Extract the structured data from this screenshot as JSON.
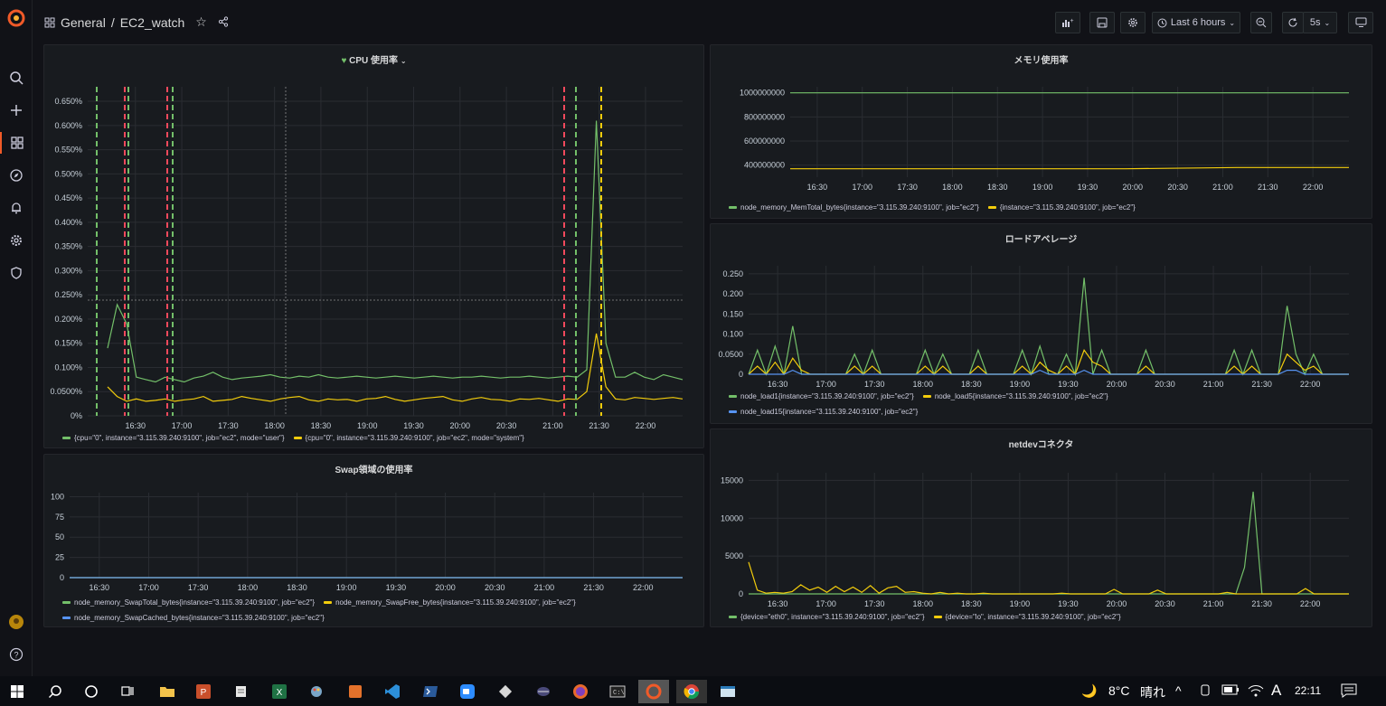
{
  "breadcrumb": {
    "folder": "General",
    "separator": "/",
    "dashboard": "EC2_watch"
  },
  "toolbar": {
    "time_range": "Last 6 hours",
    "refresh_interval": "5s"
  },
  "colors": {
    "green": "#73bf69",
    "yellow": "#f2cc0c",
    "blue": "#5794f2",
    "red_marker": "#f2495c",
    "accent": "#f05a28"
  },
  "panels": {
    "cpu": {
      "title": "CPU 使用率",
      "legend": [
        "{cpu=\"0\", instance=\"3.115.39.240:9100\", job=\"ec2\", mode=\"user\"}",
        "{cpu=\"0\", instance=\"3.115.39.240:9100\", job=\"ec2\", mode=\"system\"}"
      ]
    },
    "memory": {
      "title": "メモリ使用率",
      "legend": [
        "node_memory_MemTotal_bytes{instance=\"3.115.39.240:9100\", job=\"ec2\"}",
        "{instance=\"3.115.39.240:9100\", job=\"ec2\"}"
      ]
    },
    "load": {
      "title": "ロードアベレージ",
      "legend": [
        "node_load1{instance=\"3.115.39.240:9100\", job=\"ec2\"}",
        "node_load5{instance=\"3.115.39.240:9100\", job=\"ec2\"}",
        "node_load15{instance=\"3.115.39.240:9100\", job=\"ec2\"}"
      ]
    },
    "swap": {
      "title": "Swap領域の使用率",
      "legend": [
        "node_memory_SwapTotal_bytes{instance=\"3.115.39.240:9100\", job=\"ec2\"}",
        "node_memory_SwapFree_bytes{instance=\"3.115.39.240:9100\", job=\"ec2\"}",
        "node_memory_SwapCached_bytes{instance=\"3.115.39.240:9100\", job=\"ec2\"}"
      ]
    },
    "net": {
      "title": "netdevコネクタ",
      "legend": [
        "{device=\"eth0\", instance=\"3.115.39.240:9100\", job=\"ec2\"}",
        "{device=\"lo\", instance=\"3.115.39.240:9100\", job=\"ec2\"}"
      ]
    }
  },
  "chart_data": [
    {
      "type": "line",
      "title": "CPU 使用率",
      "x_ticks": [
        "16:30",
        "17:00",
        "17:30",
        "18:00",
        "18:30",
        "19:00",
        "19:30",
        "20:00",
        "20:30",
        "21:00",
        "21:30",
        "22:00"
      ],
      "y_ticks": [
        "0%",
        "0.0500%",
        "0.100%",
        "0.150%",
        "0.200%",
        "0.250%",
        "0.300%",
        "0.350%",
        "0.400%",
        "0.450%",
        "0.500%",
        "0.550%",
        "0.600%",
        "0.650%"
      ],
      "ylim": [
        0,
        0.0068
      ],
      "series": [
        {
          "name": "{cpu=\"0\", instance=\"3.115.39.240:9100\", job=\"ec2\", mode=\"user\"}",
          "values": [
            0.0014,
            0.0023,
            0.0019,
            0.0008,
            0.00075,
            0.0007,
            0.0008,
            0.00075,
            0.0007,
            0.00078,
            0.00082,
            0.0009,
            0.0008,
            0.00075,
            0.00078,
            0.0008,
            0.00082,
            0.00085,
            0.0008,
            0.00078,
            0.00082,
            0.0008,
            0.00085,
            0.0008,
            0.00078,
            0.0008,
            0.00082,
            0.0008,
            0.00078,
            0.0008,
            0.00082,
            0.0008,
            0.00078,
            0.0008,
            0.00082,
            0.0008,
            0.00078,
            0.0008,
            0.0008,
            0.00082,
            0.0008,
            0.00078,
            0.0008,
            0.0008,
            0.00082,
            0.0008,
            0.00078,
            0.0008,
            0.00082,
            0.0008,
            0.00095,
            0.0061,
            0.0015,
            0.0008,
            0.0008,
            0.0009,
            0.0008,
            0.00075,
            0.00085,
            0.0008,
            0.00075
          ]
        },
        {
          "name": "{cpu=\"0\", instance=\"3.115.39.240:9100\", job=\"ec2\", mode=\"system\"}",
          "values": [
            0.0006,
            0.0004,
            0.0003,
            0.00035,
            0.0003,
            0.00032,
            0.00035,
            0.0003,
            0.00033,
            0.00035,
            0.0004,
            0.0003,
            0.00032,
            0.00034,
            0.0004,
            0.00036,
            0.00033,
            0.0003,
            0.00035,
            0.00038,
            0.0004,
            0.00033,
            0.0003,
            0.00035,
            0.00033,
            0.00034,
            0.0003,
            0.00035,
            0.00036,
            0.0004,
            0.00034,
            0.0003,
            0.00033,
            0.00036,
            0.00038,
            0.0004,
            0.00033,
            0.0003,
            0.00035,
            0.00038,
            0.00034,
            0.00033,
            0.0003,
            0.00035,
            0.00034,
            0.00036,
            0.00033,
            0.0003,
            0.00035,
            0.00034,
            0.0005,
            0.0017,
            0.0006,
            0.00035,
            0.00033,
            0.00038,
            0.00036,
            0.00034,
            0.00036,
            0.00038,
            0.00035
          ]
        }
      ]
    },
    {
      "type": "line",
      "title": "メモリ使用率",
      "x_ticks": [
        "16:30",
        "17:00",
        "17:30",
        "18:00",
        "18:30",
        "19:00",
        "19:30",
        "20:00",
        "20:30",
        "21:00",
        "21:30",
        "22:00"
      ],
      "y_ticks": [
        "400000000",
        "600000000",
        "800000000",
        "1000000000"
      ],
      "ylim": [
        300000000,
        1050000000
      ],
      "series": [
        {
          "name": "node_memory_MemTotal_bytes{instance=\"3.115.39.240:9100\", job=\"ec2\"}",
          "values": [
            1000000000,
            1000000000
          ]
        },
        {
          "name": "{instance=\"3.115.39.240:9100\", job=\"ec2\"}",
          "values": [
            370000000,
            370000000,
            370000000,
            370000000,
            380000000,
            380000000
          ]
        }
      ]
    },
    {
      "type": "line",
      "title": "ロードアベレージ",
      "x_ticks": [
        "16:30",
        "17:00",
        "17:30",
        "18:00",
        "18:30",
        "19:00",
        "19:30",
        "20:00",
        "20:30",
        "21:00",
        "21:30",
        "22:00"
      ],
      "y_ticks": [
        "0",
        "0.0500",
        "0.100",
        "0.150",
        "0.200",
        "0.250"
      ],
      "ylim": [
        0,
        0.27
      ],
      "series": [
        {
          "name": "node_load1{instance=\"3.115.39.240:9100\", job=\"ec2\"}",
          "values": [
            0,
            0.06,
            0,
            0.07,
            0,
            0.12,
            0,
            0,
            0,
            0,
            0,
            0,
            0.05,
            0,
            0.06,
            0,
            0,
            0,
            0,
            0,
            0.06,
            0,
            0.05,
            0,
            0,
            0,
            0.06,
            0,
            0,
            0,
            0,
            0.06,
            0,
            0.07,
            0,
            0,
            0.05,
            0,
            0.24,
            0,
            0.06,
            0,
            0,
            0,
            0,
            0.06,
            0,
            0,
            0,
            0,
            0,
            0,
            0,
            0,
            0,
            0.06,
            0,
            0.06,
            0,
            0,
            0,
            0.17,
            0.05,
            0,
            0.05,
            0,
            0,
            0,
            0
          ]
        },
        {
          "name": "node_load5{instance=\"3.115.39.240:9100\", job=\"ec2\"}",
          "values": [
            0,
            0.02,
            0,
            0.03,
            0,
            0.04,
            0.01,
            0,
            0,
            0,
            0,
            0,
            0.02,
            0,
            0.02,
            0,
            0,
            0,
            0,
            0,
            0.02,
            0,
            0.02,
            0,
            0,
            0,
            0.02,
            0,
            0,
            0,
            0,
            0.02,
            0,
            0.03,
            0.01,
            0,
            0.02,
            0,
            0.06,
            0.03,
            0.02,
            0,
            0,
            0,
            0,
            0.02,
            0,
            0,
            0,
            0,
            0,
            0,
            0,
            0,
            0,
            0.02,
            0,
            0.02,
            0,
            0,
            0,
            0.05,
            0.03,
            0.01,
            0.02,
            0,
            0,
            0,
            0
          ]
        },
        {
          "name": "node_load15{instance=\"3.115.39.240:9100\", job=\"ec2\"}",
          "values": [
            0,
            0,
            0,
            0,
            0,
            0.01,
            0,
            0,
            0,
            0,
            0,
            0,
            0,
            0,
            0,
            0,
            0,
            0,
            0,
            0,
            0,
            0,
            0,
            0,
            0,
            0,
            0,
            0,
            0,
            0,
            0,
            0,
            0,
            0.01,
            0,
            0,
            0,
            0,
            0.01,
            0,
            0,
            0,
            0,
            0,
            0,
            0,
            0,
            0,
            0,
            0,
            0,
            0,
            0,
            0,
            0,
            0,
            0,
            0,
            0,
            0,
            0,
            0.01,
            0.01,
            0,
            0,
            0,
            0,
            0,
            0
          ]
        }
      ]
    },
    {
      "type": "line",
      "title": "Swap領域の使用率",
      "x_ticks": [
        "16:30",
        "17:00",
        "17:30",
        "18:00",
        "18:30",
        "19:00",
        "19:30",
        "20:00",
        "20:30",
        "21:00",
        "21:30",
        "22:00"
      ],
      "y_ticks": [
        "0",
        "25",
        "50",
        "75",
        "100"
      ],
      "ylim": [
        0,
        105
      ],
      "series": [
        {
          "name": "node_memory_SwapTotal_bytes{instance=\"3.115.39.240:9100\", job=\"ec2\"}",
          "values": [
            0,
            0
          ]
        },
        {
          "name": "node_memory_SwapFree_bytes{instance=\"3.115.39.240:9100\", job=\"ec2\"}",
          "values": [
            0,
            0
          ]
        },
        {
          "name": "node_memory_SwapCached_bytes{instance=\"3.115.39.240:9100\", job=\"ec2\"}",
          "values": [
            0,
            0
          ]
        }
      ]
    },
    {
      "type": "line",
      "title": "netdevコネクタ",
      "x_ticks": [
        "16:30",
        "17:00",
        "17:30",
        "18:00",
        "18:30",
        "19:00",
        "19:30",
        "20:00",
        "20:30",
        "21:00",
        "21:30",
        "22:00"
      ],
      "y_ticks": [
        "0",
        "5000",
        "10000",
        "15000"
      ],
      "ylim": [
        0,
        16000
      ],
      "series": [
        {
          "name": "{device=\"eth0\", instance=\"3.115.39.240:9100\", job=\"ec2\"}",
          "values": [
            0,
            0,
            0,
            0,
            0,
            0,
            0,
            0,
            0,
            0,
            0,
            0,
            0,
            0,
            0,
            0,
            0,
            0,
            0,
            0,
            0,
            0,
            0,
            0,
            0,
            0,
            0,
            0,
            0,
            0,
            0,
            0,
            0,
            0,
            0,
            0,
            0,
            0,
            0,
            0,
            0,
            0,
            0,
            0,
            0,
            0,
            0,
            0,
            0,
            0,
            0,
            0,
            0,
            0,
            0,
            0,
            0,
            3500,
            13500,
            0,
            0,
            0,
            0,
            0,
            0,
            0,
            0,
            0,
            0,
            0
          ]
        },
        {
          "name": "{device=\"lo\", instance=\"3.115.39.240:9100\", job=\"ec2\"}",
          "values": [
            4200,
            500,
            100,
            200,
            100,
            300,
            1200,
            500,
            900,
            200,
            1000,
            300,
            900,
            200,
            1100,
            100,
            800,
            1000,
            200,
            300,
            100,
            0,
            200,
            0,
            100,
            0,
            0,
            100,
            0,
            0,
            0,
            0,
            0,
            0,
            0,
            0,
            100,
            0,
            0,
            0,
            0,
            0,
            600,
            0,
            0,
            0,
            0,
            500,
            0,
            0,
            0,
            0,
            0,
            0,
            0,
            200,
            0,
            0,
            0,
            0,
            0,
            0,
            0,
            0,
            700,
            0,
            0,
            0,
            0,
            0
          ]
        }
      ]
    }
  ],
  "taskbar": {
    "weather_temp": "8°C",
    "weather_text": "晴れ",
    "ime": "A",
    "clock": "22:11"
  }
}
